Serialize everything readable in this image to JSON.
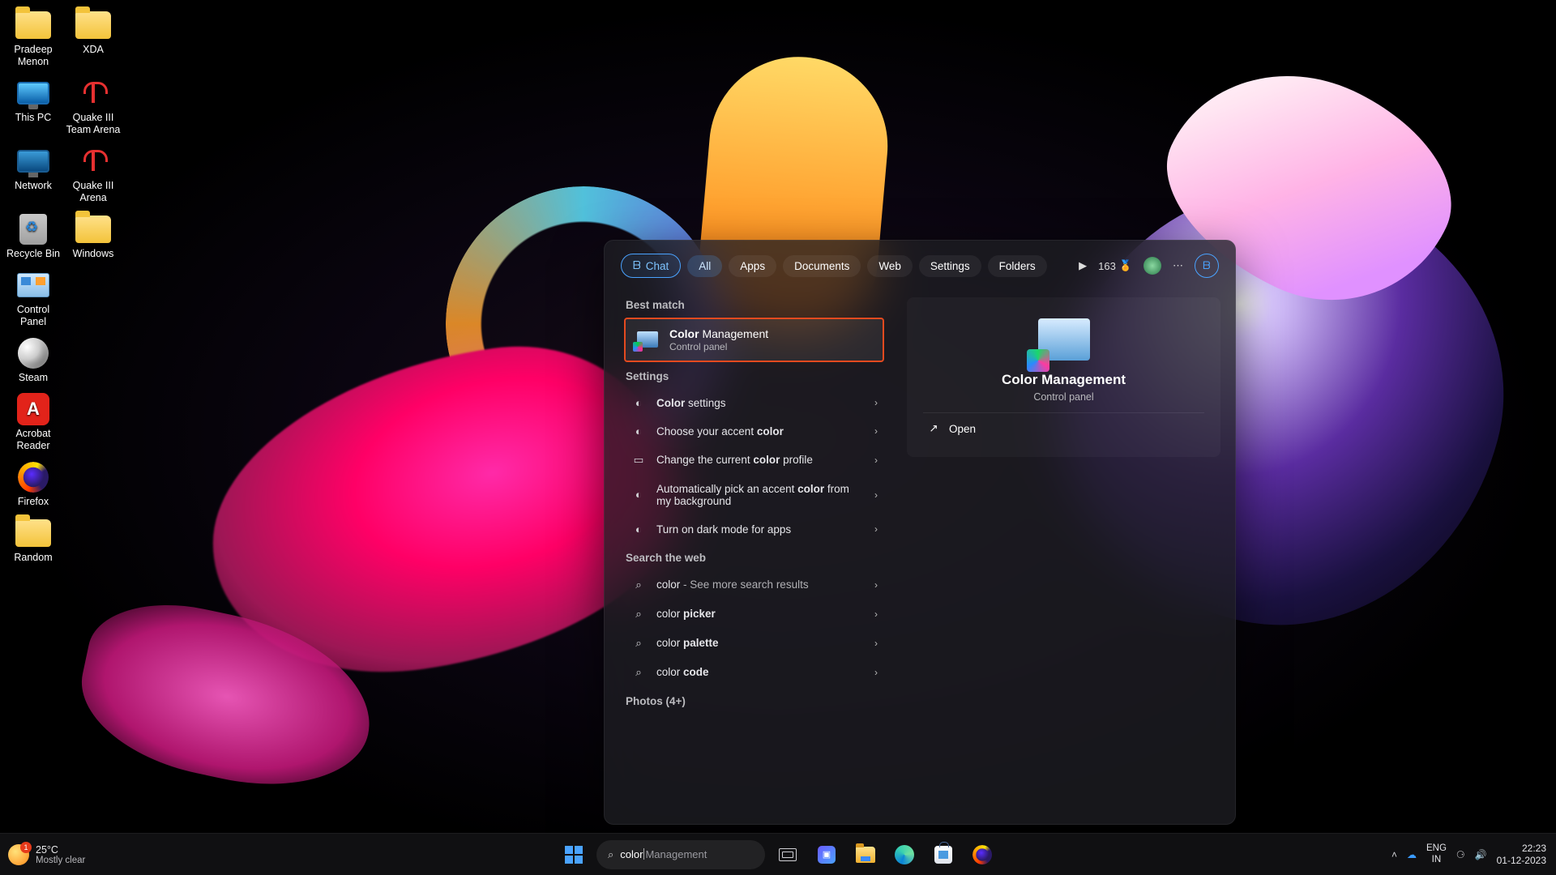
{
  "desktop_icons": {
    "pradeep": "Pradeep Menon",
    "xda": "XDA",
    "thispc": "This PC",
    "q3ta": "Quake III Team Arena",
    "network": "Network",
    "q3a": "Quake III Arena",
    "recycle": "Recycle Bin",
    "windows": "Windows",
    "cpanel": "Control Panel",
    "steam": "Steam",
    "acrobat": "Acrobat Reader",
    "firefox": "Firefox",
    "random": "Random"
  },
  "start": {
    "tabs": {
      "chat": "Chat",
      "all": "All",
      "apps": "Apps",
      "documents": "Documents",
      "web": "Web",
      "settings": "Settings",
      "folders": "Folders"
    },
    "points": "163",
    "sections": {
      "best": "Best match",
      "settings": "Settings",
      "web": "Search the web",
      "photos": "Photos (4+)"
    },
    "best_match": {
      "title_bold": "Color",
      "title_rest": " Management",
      "subtitle": "Control panel"
    },
    "settings_rows": {
      "r1_bold": "Color",
      "r1_rest": " settings",
      "r2_pre": "Choose your accent ",
      "r2_bold": "color",
      "r3_pre": "Change the current ",
      "r3_bold": "color",
      "r3_post": " profile",
      "r4_pre": "Automatically pick an accent ",
      "r4_bold": "color",
      "r4_post": " from my background",
      "r5": "Turn on dark mode for apps"
    },
    "web_rows": {
      "r1_term": "color",
      "r1_desc": " - See more search results",
      "r2_pre": "color ",
      "r2_bold": "picker",
      "r3_pre": "color ",
      "r3_bold": "palette",
      "r4_pre": "color ",
      "r4_bold": "code"
    },
    "preview": {
      "title": "Color Management",
      "subtitle": "Control panel",
      "open": "Open"
    }
  },
  "taskbar": {
    "weather_temp": "25°C",
    "weather_desc": "Mostly clear",
    "search_typed": "color",
    "search_suggest": "Management",
    "lang_top": "ENG",
    "lang_bot": "IN",
    "time": "22:23",
    "date": "01-12-2023"
  }
}
